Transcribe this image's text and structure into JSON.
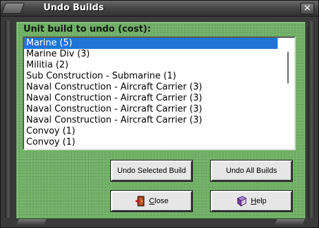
{
  "window": {
    "title": "Undo Builds",
    "close_glyph": "✕"
  },
  "list_label": "Unit build to undo (cost):",
  "units": [
    "Marine (5)",
    "Marine Div (3)",
    "Militia (2)",
    "Sub Construction - Submarine (1)",
    "Naval Construction - Aircraft Carrier (3)",
    "Naval Construction - Aircraft Carrier (3)",
    "Naval Construction - Aircraft Carrier (3)",
    "Naval Construction - Aircraft Carrier (3)",
    "Convoy (1)",
    "Convoy (1)"
  ],
  "selected_index": 0,
  "buttons": {
    "undo_selected": "Undo Selected Build",
    "undo_all": "Undo All Builds",
    "close_first": "C",
    "close_rest": "lose",
    "help_first": "H",
    "help_rest": "elp"
  },
  "icons": {
    "close": "door-exit-icon",
    "help": "help-book-icon"
  },
  "colors": {
    "pane": "#6fb065",
    "selection": "#1f74d6"
  }
}
